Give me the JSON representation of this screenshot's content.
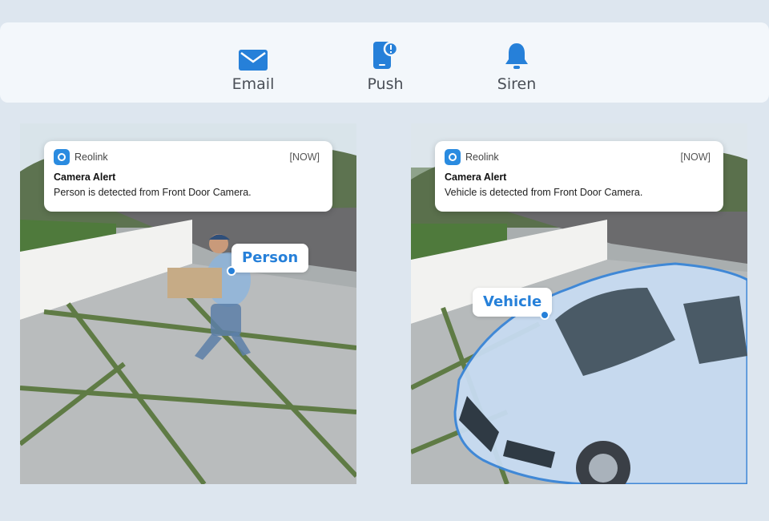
{
  "alert_methods": [
    {
      "label": "Email",
      "icon": "envelope-icon"
    },
    {
      "label": "Push",
      "icon": "phone-alert-icon"
    },
    {
      "label": "Siren",
      "icon": "bell-icon"
    }
  ],
  "colors": {
    "accent": "#2680d9",
    "background": "#dde6ef"
  },
  "panels": [
    {
      "notification": {
        "app_name": "Reolink",
        "time": "[NOW]",
        "title": "Camera Alert",
        "message": "Person is detected from Front Door Camera."
      },
      "detection_label": "Person"
    },
    {
      "notification": {
        "app_name": "Reolink",
        "time": "[NOW]",
        "title": "Camera Alert",
        "message": "Vehicle is detected from Front Door Camera."
      },
      "detection_label": "Vehicle"
    }
  ]
}
